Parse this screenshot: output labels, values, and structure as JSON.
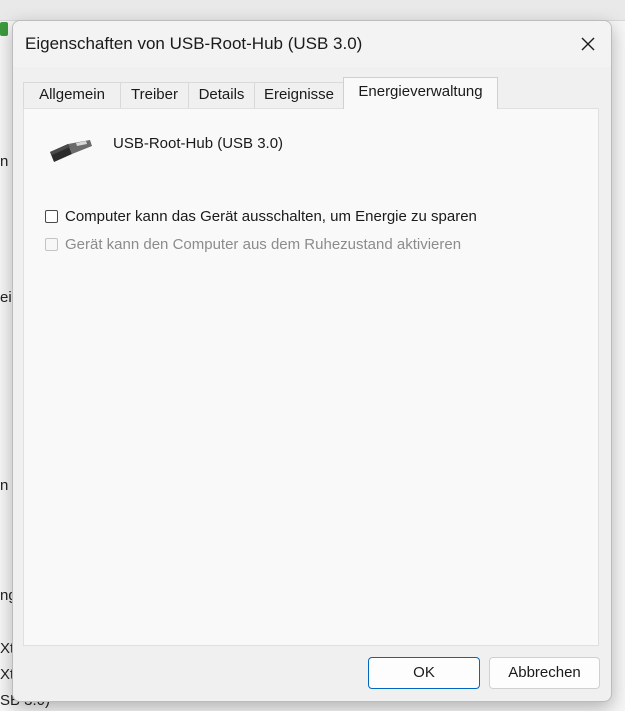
{
  "background": {
    "fragments": [
      "n",
      "eig",
      "n",
      "ng",
      "Xt",
      "Xt",
      "SB 3.0)"
    ]
  },
  "dialog": {
    "title": "Eigenschaften von USB-Root-Hub (USB 3.0)",
    "close_glyph": "✕",
    "tabs": [
      {
        "label": "Allgemein",
        "active": false
      },
      {
        "label": "Treiber",
        "active": false
      },
      {
        "label": "Details",
        "active": false
      },
      {
        "label": "Ereignisse",
        "active": false
      },
      {
        "label": "Energieverwaltung",
        "active": true
      }
    ],
    "device": {
      "icon": "usb-connector-icon",
      "name": "USB-Root-Hub (USB 3.0)"
    },
    "options": [
      {
        "label": "Computer kann das Gerät ausschalten, um Energie zu sparen",
        "checked": false,
        "enabled": true
      },
      {
        "label": "Gerät kann den Computer aus dem Ruhezustand aktivieren",
        "checked": false,
        "enabled": false
      }
    ],
    "buttons": {
      "ok": "OK",
      "cancel": "Abbrechen"
    }
  }
}
